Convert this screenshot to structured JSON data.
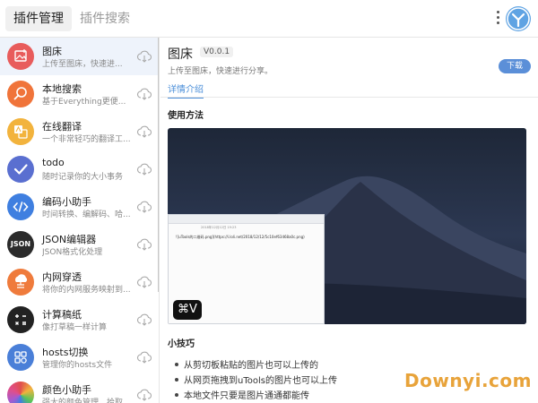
{
  "header": {
    "tabs": [
      {
        "label": "插件管理",
        "active": true
      },
      {
        "label": "插件搜索",
        "active": false
      }
    ]
  },
  "sidebar": {
    "items": [
      {
        "title": "图床",
        "subtitle": "上传至图床，快速进...",
        "icon": "image-upload-icon",
        "color": "#e85c5c",
        "selected": true
      },
      {
        "title": "本地搜索",
        "subtitle": "基于Everything更便...",
        "icon": "search-icon",
        "color": "#f0743a"
      },
      {
        "title": "在线翻译",
        "subtitle": "一个非常轻巧的翻译工...",
        "icon": "translate-icon",
        "color": "#f2b33d"
      },
      {
        "title": "todo",
        "subtitle": "随时记录你的大小事务",
        "icon": "check-icon",
        "color": "#5a6fd0"
      },
      {
        "title": "编码小助手",
        "subtitle": "时间转换、编解码、哈...",
        "icon": "code-icon",
        "color": "#3f7fe0"
      },
      {
        "title": "JSON编辑器",
        "subtitle": "JSON格式化处理",
        "icon": "json-icon",
        "color": "#2b2b2b"
      },
      {
        "title": "内网穿透",
        "subtitle": "将你的内网服务映射到...",
        "icon": "network-icon",
        "color": "#ef7b3c"
      },
      {
        "title": "计算稿纸",
        "subtitle": "像打草稿一样计算",
        "icon": "calculator-icon",
        "color": "#222222"
      },
      {
        "title": "hosts切换",
        "subtitle": "管理你的hosts文件",
        "icon": "hosts-icon",
        "color": "#4a7fd8"
      },
      {
        "title": "颜色小助手",
        "subtitle": "强大的颜色管理，拾取...",
        "icon": "color-wheel-icon",
        "color": "#e04e8a"
      }
    ]
  },
  "detail": {
    "title": "图床",
    "version": "V0.0.1",
    "description": "上传至图床，快速进行分享。",
    "download_label": "下载",
    "tab_label": "详情介绍",
    "usage_heading": "使用方法",
    "screenshot": {
      "timestamp": "2018年12月12日 19:23",
      "url_text": "![uTools的二维码.png](https://i.loli.net/2018/12/12/5c10ef63468a0c.png)",
      "shortcut": "⌘V"
    },
    "tips_heading": "小技巧",
    "tips": [
      "从剪切板粘贴的图片也可以上传的",
      "从网页拖拽到uTools的图片也可以上传",
      "本地文件只要是图片通通都能传"
    ]
  },
  "watermark": "Downyi.com"
}
